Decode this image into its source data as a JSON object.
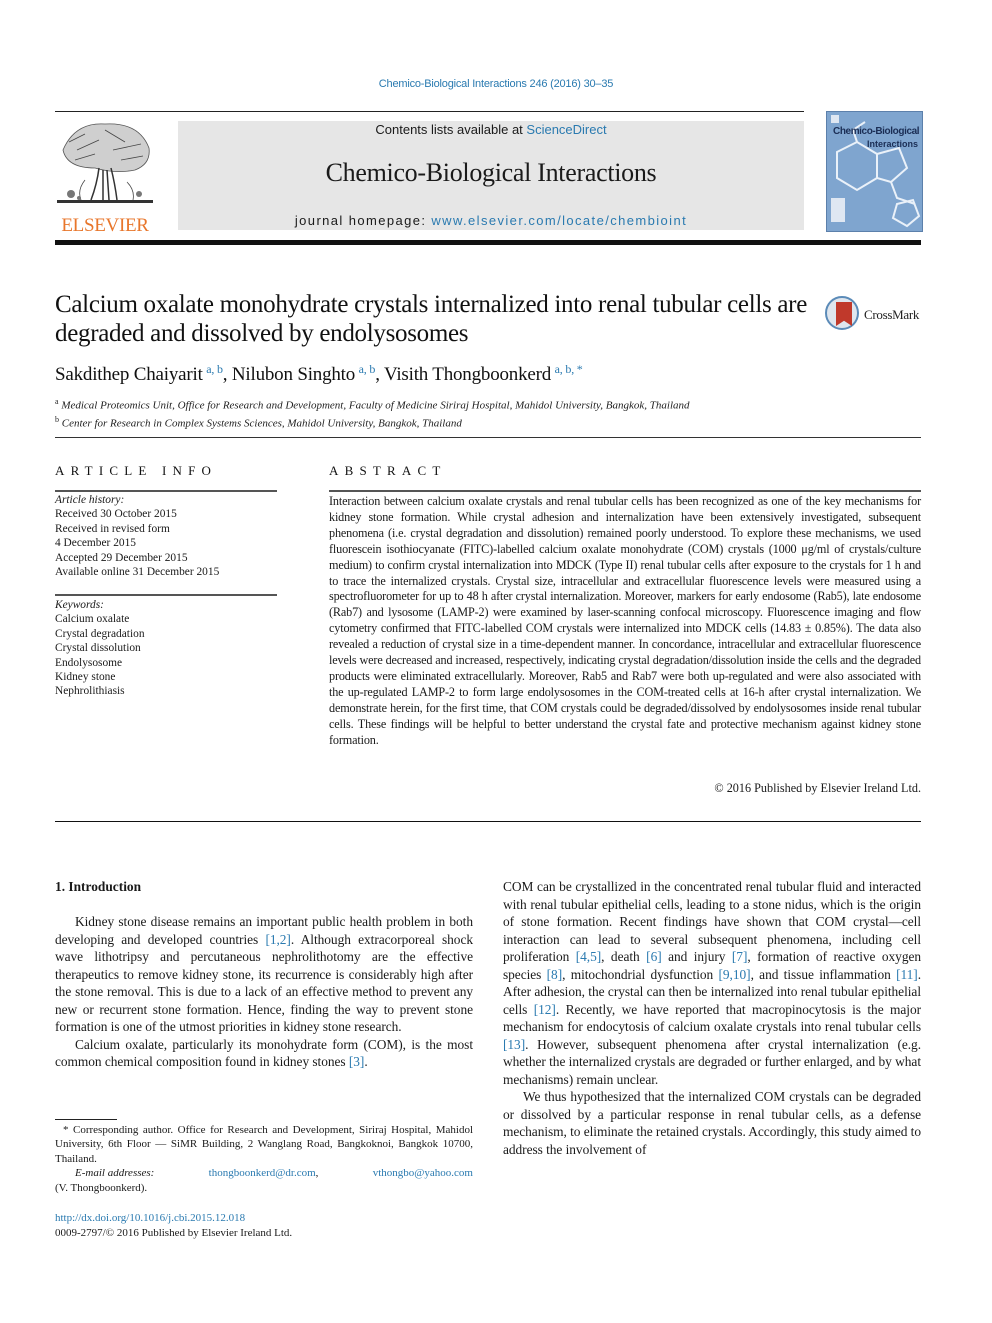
{
  "header": {
    "running_head": "Chemico-Biological Interactions 246 (2016) 30–35",
    "publisher_logo_text": "ELSEVIER",
    "contents_prefix": "Contents lists available at ",
    "contents_link": "ScienceDirect",
    "journal_title": "Chemico-Biological Interactions",
    "homepage_prefix": "journal homepage: ",
    "homepage_link": "www.elsevier.com/locate/chembioint",
    "cover_title_line1": "Chemico-Biological",
    "cover_title_line2": "Interactions",
    "colors": {
      "link": "#2a7ab0",
      "elsevier_orange": "#e8762b",
      "banner_grey": "#e6e6e6",
      "cover_blue": "#7fa5cf"
    }
  },
  "article": {
    "title": "Calcium oxalate monohydrate crystals internalized into renal tubular cells are degraded and dissolved by endolysosomes",
    "crossmark_label": "CrossMark",
    "authors": [
      {
        "name": "Sakdithep Chaiyarit",
        "affil": "a, b"
      },
      {
        "name": "Nilubon Singhto",
        "affil": "a, b"
      },
      {
        "name": "Visith Thongboonkerd",
        "affil": "a, b, *"
      }
    ],
    "affiliations": [
      {
        "mark": "a",
        "text": "Medical Proteomics Unit, Office for Research and Development, Faculty of Medicine Siriraj Hospital, Mahidol University, Bangkok, Thailand"
      },
      {
        "mark": "b",
        "text": "Center for Research in Complex Systems Sciences, Mahidol University, Bangkok, Thailand"
      }
    ]
  },
  "article_info": {
    "heading": "ARTICLE INFO",
    "history_label": "Article history:",
    "history": [
      "Received 30 October 2015",
      "Received in revised form",
      "4 December 2015",
      "Accepted 29 December 2015",
      "Available online 31 December 2015"
    ],
    "keywords_label": "Keywords:",
    "keywords": [
      "Calcium oxalate",
      "Crystal degradation",
      "Crystal dissolution",
      "Endolysosome",
      "Kidney stone",
      "Nephrolithiasis"
    ]
  },
  "abstract": {
    "heading": "ABSTRACT",
    "text": "Interaction between calcium oxalate crystals and renal tubular cells has been recognized as one of the key mechanisms for kidney stone formation. While crystal adhesion and internalization have been extensively investigated, subsequent phenomena (i.e. crystal degradation and dissolution) remained poorly understood. To explore these mechanisms, we used fluorescein isothiocyanate (FITC)-labelled calcium oxalate monohydrate (COM) crystals (1000 μg/ml of crystals/culture medium) to confirm crystal internalization into MDCK (Type II) renal tubular cells after exposure to the crystals for 1 h and to trace the internalized crystals. Crystal size, intracellular and extracellular fluorescence levels were measured using a spectrofluorometer for up to 48 h after crystal internalization. Moreover, markers for early endosome (Rab5), late endosome (Rab7) and lysosome (LAMP-2) were examined by laser-scanning confocal microscopy. Fluorescence imaging and flow cytometry confirmed that FITC-labelled COM crystals were internalized into MDCK cells (14.83 ± 0.85%). The data also revealed a reduction of crystal size in a time-dependent manner. In concordance, intracellular and extracellular fluorescence levels were decreased and increased, respectively, indicating crystal degradation/dissolution inside the cells and the degraded products were eliminated extracellularly. Moreover, Rab5 and Rab7 were both up-regulated and were also associated with the up-regulated LAMP-2 to form large endolysosomes in the COM-treated cells at 16-h after crystal internalization. We demonstrate herein, for the first time, that COM crystals could be degraded/dissolved by endolysosomes inside renal tubular cells. These findings will be helpful to better understand the crystal fate and protective mechanism against kidney stone formation.",
    "copyright": "© 2016 Published by Elsevier Ireland Ltd."
  },
  "body": {
    "section_heading": "1.  Introduction",
    "left_paragraphs": [
      [
        {
          "t": "Kidney stone disease remains an important public health problem in both developing and developed countries "
        },
        {
          "ref": "[1,2]"
        },
        {
          "t": ". Although extracorporeal shock wave lithotripsy and percutaneous nephrolithotomy are the effective therapeutics to remove kidney stone, its recurrence is considerably high after the stone removal. This is due to a lack of an effective method to prevent any new or recurrent stone formation. Hence, finding the way to prevent stone formation is one of the utmost priorities in kidney stone research."
        }
      ],
      [
        {
          "t": "Calcium oxalate, particularly its monohydrate form (COM), is the most common chemical composition found in kidney stones "
        },
        {
          "ref": "[3]"
        },
        {
          "t": "."
        }
      ]
    ],
    "right_paragraphs": [
      [
        {
          "t": "COM can be crystallized in the concentrated renal tubular fluid and interacted with renal tubular epithelial cells, leading to a stone nidus, which is the origin of stone formation. Recent findings have shown that COM crystal—cell interaction can lead to several subsequent phenomena, including cell proliferation "
        },
        {
          "ref": "[4,5]"
        },
        {
          "t": ", death "
        },
        {
          "ref": "[6]"
        },
        {
          "t": " and injury "
        },
        {
          "ref": "[7]"
        },
        {
          "t": ", formation of reactive oxygen species "
        },
        {
          "ref": "[8]"
        },
        {
          "t": ", mitochondrial dysfunction "
        },
        {
          "ref": "[9,10]"
        },
        {
          "t": ", and tissue inflammation "
        },
        {
          "ref": "[11]"
        },
        {
          "t": ". After adhesion, the crystal can then be internalized into renal tubular epithelial cells "
        },
        {
          "ref": "[12]"
        },
        {
          "t": ". Recently, we have reported that macropinocytosis is the major mechanism for endocytosis of calcium oxalate crystals into renal tubular cells "
        },
        {
          "ref": "[13]"
        },
        {
          "t": ". However, subsequent phenomena after crystal internalization (e.g. whether the internalized crystals are degraded or further enlarged, and by what mechanisms) remain unclear."
        }
      ],
      [
        {
          "t": "We thus hypothesized that the internalized COM crystals can be degraded or dissolved by a particular response in renal tubular cells, as a defense mechanism, to eliminate the retained crystals. Accordingly, this study aimed to address the involvement of"
        }
      ]
    ]
  },
  "footnote": {
    "corresponding": "* Corresponding author. Office for Research and Development, Siriraj Hospital, Mahidol University, 6th Floor — SiMR Building, 2 Wanglang Road, Bangkoknoi, Bangkok 10700, Thailand.",
    "email_label": "E-mail addresses:",
    "emails": [
      "thongboonkerd@dr.com",
      "vthongbo@yahoo.com"
    ],
    "email_owner": "(V. Thongboonkerd).",
    "doi": "http://dx.doi.org/10.1016/j.cbi.2015.12.018",
    "issn_copyright": "0009-2797/© 2016 Published by Elsevier Ireland Ltd."
  }
}
